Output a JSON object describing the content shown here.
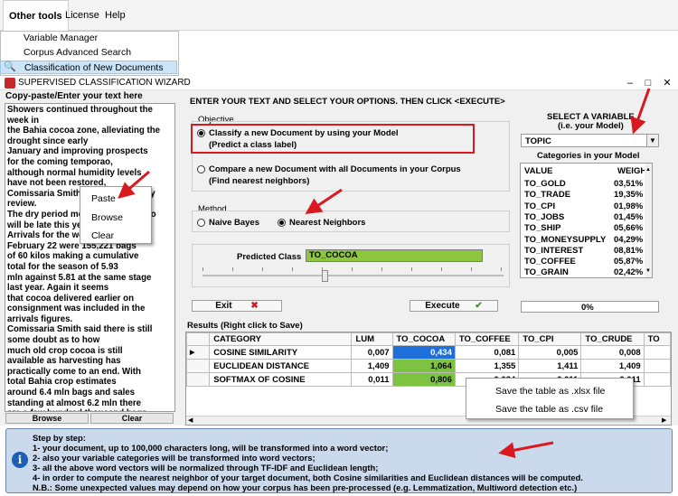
{
  "menubar": {
    "items": [
      "Other tools",
      "License",
      "Help"
    ],
    "dropdown": [
      "Variable Manager",
      "Corpus Advanced Search",
      "Classification of New Documents"
    ]
  },
  "window": {
    "title": "SUPERVISED CLASSIFICATION WIZARD",
    "controls": [
      "–",
      "□",
      "✕"
    ]
  },
  "left": {
    "header": "Copy-paste/Enter your text here",
    "text": "Showers continued throughout the\nweek in\nthe Bahia cocoa zone, alleviating the\ndrought since early\nJanuary and improving prospects\nfor the coming temporao,\nalthough normal humidity levels\nhave not been restored,\nComissaria Smith said in its weekly\nreview.\nThe dry period means the temporao\nwill be late this year.\nArrivals for the week ended\nFebruary 22 were 155,221 bags\nof 60 kilos making a cumulative\ntotal for the season of 5.93\nmln against 5.81 at the same stage\nlast year. Again it seems\nthat cocoa delivered earlier on\nconsignment was included in the\narrivals figures.\nComissaria Smith said there is still\nsome doubt as to how\nmuch old crop cocoa is still\navailable as harvesting has\npractically come to an end. With\ntotal Bahia crop estimates\naround 6.4 mln bags and sales\nstanding at almost 6.2 mln there\nare a few hundred thousand bags\nstill in the hands of farmers,\nmiddlemen, exporters and\nprocessors.\nThere are doubts as to how much of\nthis cocoa would be fit\nfor export as shippers are now\nexperiencing dificulties in",
    "browse_label": "Browse",
    "clear_label": "Clear",
    "context_menu": [
      "Paste",
      "Browse",
      "Clear"
    ]
  },
  "main": {
    "instruction": "ENTER YOUR TEXT AND SELECT YOUR OPTIONS. THEN CLICK <EXECUTE>",
    "objective_title": "Objective",
    "objective_options": [
      {
        "line1": "Classify a new Document by using your Model",
        "line2": "(Predict a class label)",
        "selected": true
      },
      {
        "line1": "Compare a new Document with all Documents in your Corpus",
        "line2": "(Find nearest neighbors)",
        "selected": false
      }
    ],
    "method_title": "Method",
    "method_options": [
      {
        "label": "Naive Bayes",
        "selected": false
      },
      {
        "label": "Nearest Neighbors",
        "selected": true
      }
    ],
    "predicted_label": "Predicted Class",
    "predicted_value": "TO_COCOA",
    "exit_label": "Exit",
    "execute_label": "Execute"
  },
  "variable": {
    "title_line1": "SELECT A VARIABLE",
    "title_line2": "(i.e. your Model)",
    "selected": "TOPIC",
    "categories_title": "Categories in your Model",
    "col_value": "VALUE",
    "col_weight": "WEIGHT",
    "rows": [
      [
        "TO_GOLD",
        "03,51%"
      ],
      [
        "TO_TRADE",
        "19,35%"
      ],
      [
        "TO_CPI",
        "01,98%"
      ],
      [
        "TO_JOBS",
        "01,45%"
      ],
      [
        "TO_SHIP",
        "05,66%"
      ],
      [
        "TO_MONEYSUPPLY",
        "04,29%"
      ],
      [
        "TO_INTEREST",
        "08,81%"
      ],
      [
        "TO_COFFEE",
        "05,87%"
      ],
      [
        "TO_GRAIN",
        "02,42%"
      ]
    ],
    "progress_text": "0%",
    "progress": 0
  },
  "results": {
    "title": "Results (Right click to Save)",
    "columns": [
      "CATEGORY",
      "LUM",
      "TO_COCOA",
      "TO_COFFEE",
      "TO_CPI",
      "TO_CRUDE",
      "TO"
    ],
    "rows": [
      [
        "COSINE SIMILARITY",
        "0,007",
        "0,434",
        "0,081",
        "0,005",
        "0,008"
      ],
      [
        "EUCLIDEAN DISTANCE",
        "1,409",
        "1,064",
        "1,355",
        "1,411",
        "1,409"
      ],
      [
        "SOFTMAX OF COSINE",
        "0,011",
        "0,806",
        "0,024",
        "0,011",
        "0,011"
      ]
    ],
    "context_menu": [
      "Save the table as .xlsx file",
      "Save the table as .csv file"
    ]
  },
  "info": {
    "lines": [
      "Step by step:",
      "1- your document, up to 100,000 characters long, will be transformed into a word vector;",
      "2- also your variable categories will be transformed into word vectors;",
      "3- all the above word vectors will be normalized through TF-IDF and Euclidean length;",
      "4- in order to compute the nearest neighbor of your target document, both Cosine similarities and Euclidean distances will be computed.",
      "N.B.: Some unexpected values may depend on how your corpus has been pre-processed (e.g. Lemmatization, Multiword detection etc.)"
    ]
  },
  "colors": {
    "highlight_red": "#d9191f",
    "predicted_green": "#8dc63f",
    "cell_blue": "#1e6fd9",
    "cell_green": "#7ec242",
    "info_bg": "#cad9eb"
  }
}
